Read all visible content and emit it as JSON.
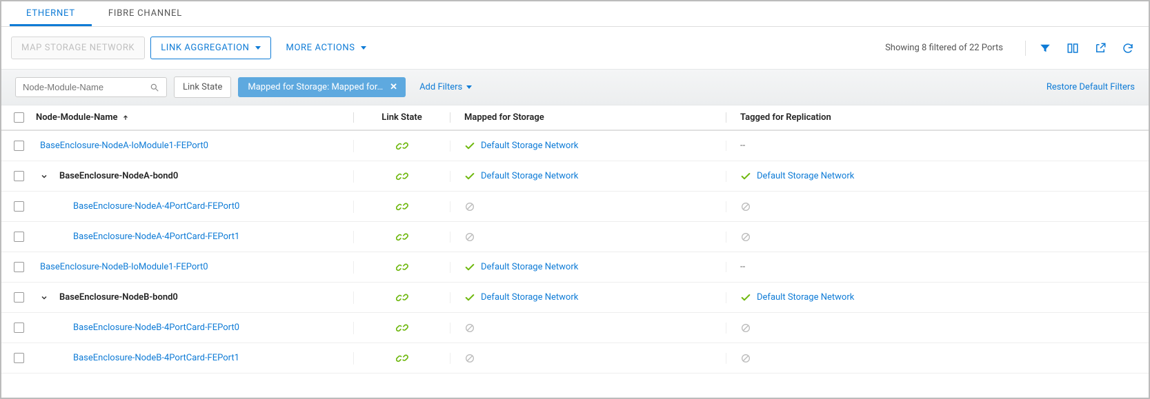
{
  "tabs": {
    "ethernet": "ETHERNET",
    "fibre_channel": "FIBRE CHANNEL"
  },
  "toolbar": {
    "map_storage_network": "MAP STORAGE NETWORK",
    "link_aggregation": "LINK AGGREGATION",
    "more_actions": "MORE ACTIONS",
    "status_text": "Showing 8 filtered of 22 Ports"
  },
  "filters": {
    "search_placeholder": "Node-Module-Name",
    "link_state_chip": "Link State",
    "active_chip": "Mapped for Storage: Mapped for…",
    "add_filters": "Add Filters",
    "restore": "Restore Default Filters"
  },
  "columns": {
    "name": "Node-Module-Name",
    "link_state": "Link State",
    "mapped": "Mapped for Storage",
    "tagged": "Tagged for Replication"
  },
  "text": {
    "default_storage_network": "Default Storage Network",
    "dash": "--"
  },
  "colors": {
    "primary": "#0e7bd6",
    "success": "#6fb80f",
    "muted": "#bfbfbf"
  },
  "chart_data": null,
  "rows": [
    {
      "name": "BaseEnclosure-NodeA-IoModule1-FEPort0",
      "name_style": "link",
      "indent": 0,
      "expand": null,
      "link": "ok",
      "mapped": "network",
      "tagged": "dash"
    },
    {
      "name": "BaseEnclosure-NodeA-bond0",
      "name_style": "plain",
      "indent": 0,
      "expand": "open",
      "link": "ok",
      "mapped": "network",
      "tagged": "network"
    },
    {
      "name": "BaseEnclosure-NodeA-4PortCard-FEPort0",
      "name_style": "link",
      "indent": 1,
      "expand": null,
      "link": "ok",
      "mapped": "blocked",
      "tagged": "blocked"
    },
    {
      "name": "BaseEnclosure-NodeA-4PortCard-FEPort1",
      "name_style": "link",
      "indent": 1,
      "expand": null,
      "link": "ok",
      "mapped": "blocked",
      "tagged": "blocked"
    },
    {
      "name": "BaseEnclosure-NodeB-IoModule1-FEPort0",
      "name_style": "link",
      "indent": 0,
      "expand": null,
      "link": "ok",
      "mapped": "network",
      "tagged": "dash"
    },
    {
      "name": "BaseEnclosure-NodeB-bond0",
      "name_style": "plain",
      "indent": 0,
      "expand": "open",
      "link": "ok",
      "mapped": "network",
      "tagged": "network"
    },
    {
      "name": "BaseEnclosure-NodeB-4PortCard-FEPort0",
      "name_style": "link",
      "indent": 1,
      "expand": null,
      "link": "ok",
      "mapped": "blocked",
      "tagged": "blocked"
    },
    {
      "name": "BaseEnclosure-NodeB-4PortCard-FEPort1",
      "name_style": "link",
      "indent": 1,
      "expand": null,
      "link": "ok",
      "mapped": "blocked",
      "tagged": "blocked"
    }
  ]
}
